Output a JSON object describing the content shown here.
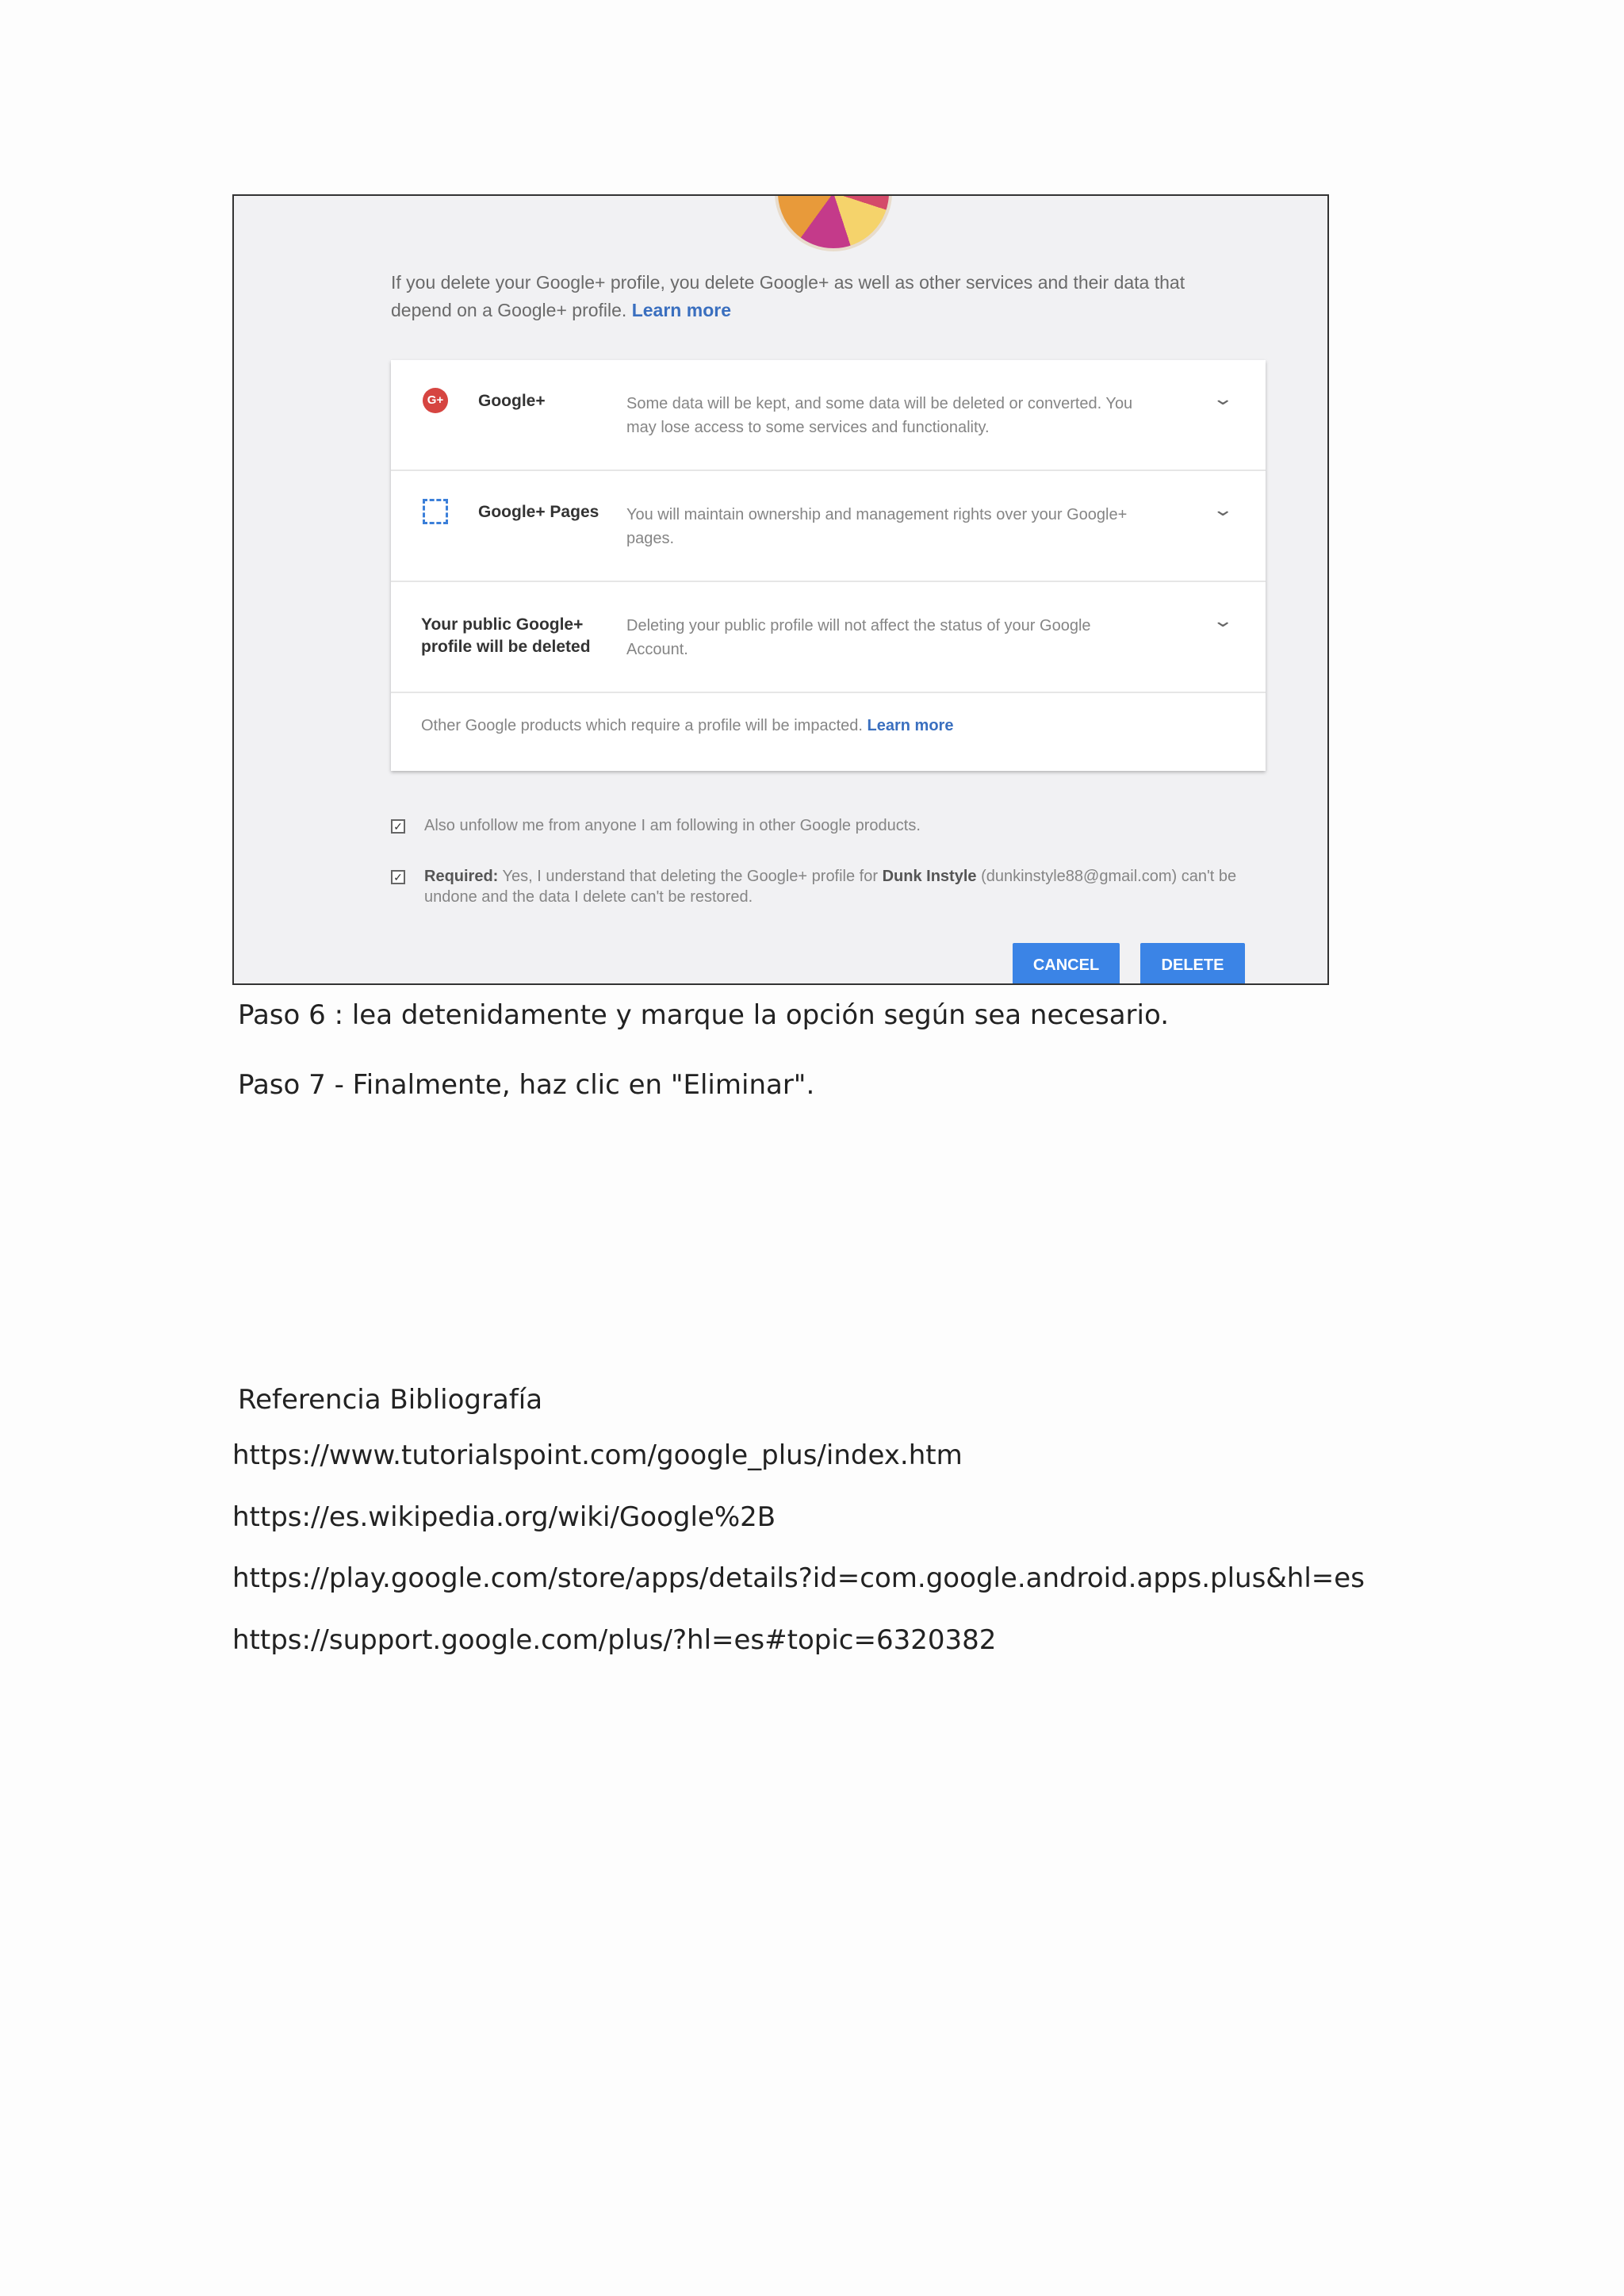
{
  "screenshot": {
    "intro_text": "If you delete your Google+ profile, you delete Google+ as well as other services and their data that depend on a Google+ profile.",
    "intro_link": "Learn more",
    "rows": [
      {
        "icon": "google-plus-icon",
        "icon_glyph": "G+",
        "name": "Google+",
        "desc": "Some data will be kept, and some data will be deleted or converted. You may lose access to some services and functionality."
      },
      {
        "icon": "google-pages-icon",
        "name": "Google+ Pages",
        "desc": "You will maintain ownership and management rights over your Google+ pages."
      },
      {
        "name": "Your public Google+ profile will be deleted",
        "desc": "Deleting your public profile will not affect the status of your Google Account."
      }
    ],
    "footer_text": "Other Google products which require a profile will be impacted.",
    "footer_link": "Learn more",
    "checkbox1_label": "Also unfollow me from anyone I am following in other Google products.",
    "checkbox2_required": "Required:",
    "checkbox2_text_a": "Yes, I understand that deleting the Google+ profile for",
    "checkbox2_user": "Dunk Instyle",
    "checkbox2_text_b": "(dunkinstyle88@gmail.com) can't be undone and the data I delete can't be restored.",
    "checkbox1_checked": true,
    "checkbox2_checked": true,
    "cancel_label": "CANCEL",
    "delete_label": "DELETE",
    "button_color": "#3b84e6",
    "link_color": "#3a6fbf"
  },
  "doc": {
    "step6_label": "Paso 6",
    "step6_text": " : lea detenidamente y marque la opción según sea necesario.",
    "step7_label": "Paso 7",
    "step7_text": " - Finalmente, haz clic en \"Eliminar\".",
    "references_title": "Referencia Bibliografía",
    "references": [
      "https://www.tutorialspoint.com/google_plus/index.htm",
      "https://es.wikipedia.org/wiki/Google%2B",
      "https://play.google.com/store/apps/details?id=com.google.android.apps.plus&hl=es",
      "https://support.google.com/plus/?hl=es#topic=6320382"
    ]
  }
}
